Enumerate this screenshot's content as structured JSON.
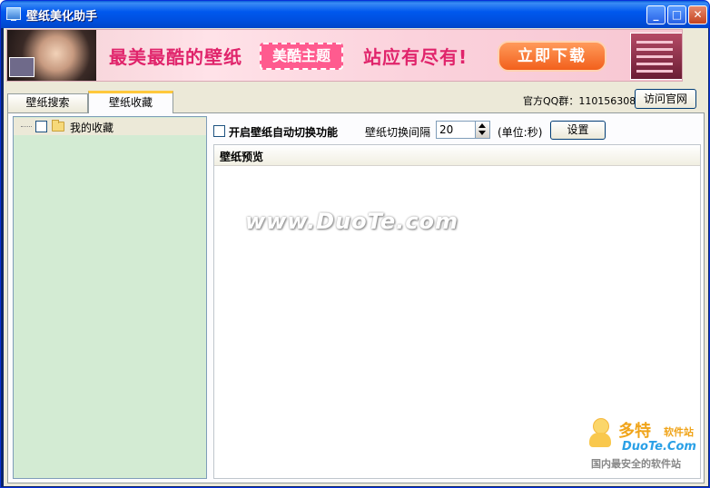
{
  "window": {
    "title": "壁纸美化助手"
  },
  "banner": {
    "text1": "最美最酷的壁纸",
    "badge": "美酷主题",
    "text2": "站应有尽有!",
    "cta": "立即下载"
  },
  "tabs": [
    {
      "label": "壁纸搜索"
    },
    {
      "label": "壁纸收藏"
    }
  ],
  "header": {
    "qq_label": "官方QQ群：110156308",
    "visit_label": "访问官网"
  },
  "tree": {
    "items": [
      {
        "label": "我的收藏"
      }
    ]
  },
  "settings": {
    "auto_label": "开启壁纸自动切换功能",
    "interval_label": "壁纸切换间隔",
    "interval_value": "20",
    "unit_label": "(单位:秒)",
    "set_label": "设置"
  },
  "preview": {
    "title": "壁纸预览"
  },
  "watermark": {
    "text": "www.DuoTe.com"
  },
  "logo": {
    "cn": "多特",
    "sub": "软件站",
    "en": "DuoTe.Com",
    "slogan": "国内最安全的软件站"
  },
  "colors": {
    "titlebar": "#0058ee",
    "tree_bg": "#d3ebd3",
    "tab_accent": "#ffc83c",
    "banner_pink": "#e0246b"
  }
}
